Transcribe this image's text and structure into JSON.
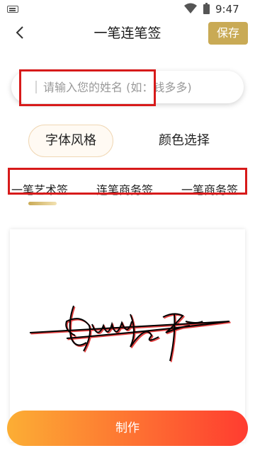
{
  "status_bar": {
    "time": "9:47",
    "icons": [
      "keyboard-icon",
      "wifi-icon",
      "battery-icon"
    ]
  },
  "header": {
    "title": "一笔连笔签",
    "save_label": "保存",
    "back_icon": "back-icon"
  },
  "name_input": {
    "value": "",
    "placeholder": "请输入您的姓名 (如：钱多多)"
  },
  "section_tabs": [
    {
      "label": "字体风格",
      "selected": true
    },
    {
      "label": "颜色选择",
      "selected": false
    }
  ],
  "style_options": [
    {
      "label": "一笔艺术签",
      "selected": true
    },
    {
      "label": "连笔商务签",
      "selected": false
    },
    {
      "label": "一笔商务签",
      "selected": false
    }
  ],
  "primary_action": {
    "label": "制作"
  },
  "colors": {
    "accent_gold": "#c9aa55",
    "annotation_red": "#d71a1a",
    "button_gradient_start": "#fcae34",
    "button_gradient_end": "#ff3c30",
    "signature_stroke": "#000000",
    "signature_shadow": "#e02020"
  }
}
